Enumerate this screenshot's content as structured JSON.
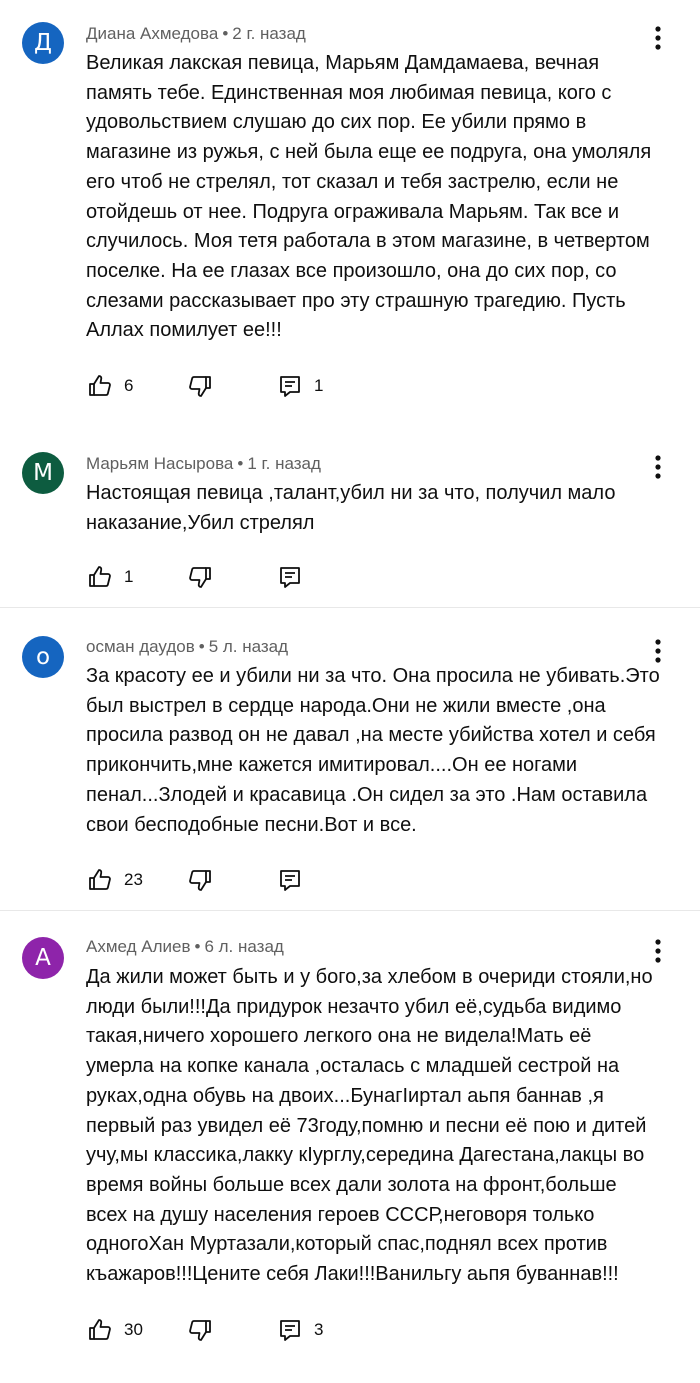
{
  "comments": [
    {
      "avatar_letter": "Д",
      "avatar_color": "#1565c0",
      "author": "Диана Ахмедова",
      "time": "2 г. назад",
      "text": "Великая лакская певица, Марьям Дамдамаева, вечная\nпамять тебе. Единственная моя любимая певица, кого с\nудовольствием слушаю до сих пор. Ее убили прямо в\nмагазине из ружья, с ней была  еще ее подруга, она умоляля\nего чтоб не стрелял, тот сказал и тебя застрелю, если не\nотойдешь от нее. Подруга ограживала Марьям. Так все и\nслучилось. Моя тетя работала в этом магазине, в четвертом\nпоселке. На ее глазах все произошло, она до сих пор, со\nслезами рассказывает про эту страшную трагедию. Пусть\nАллах помилует ее!!!",
      "likes": "6",
      "replies": "1"
    },
    {
      "avatar_letter": "М",
      "avatar_color": "#0d5c40",
      "author": "Марьям Насырова",
      "time": "1 г. назад",
      "text": "Настоящая певица ,талант,убил ни за что, получил мало\nнаказание,Убил стрелял",
      "likes": "1",
      "replies": ""
    },
    {
      "avatar_letter": "о",
      "avatar_color": "#1565c0",
      "author": "осман даудов",
      "time": "5 л. назад",
      "text": "За красоту ее и убили ни за что. Она просила не убивать.Это\nбыл выстрел в сердце народа.Они не жили вместе ,она\nпросила развод он не давал ,на месте убийства хотел и себя\nприкончить,мне кажется имитировал....Он ее ногами\nпенал...Злодей и красавица .Он сидел за это .Нам оставила\nсвои бесподобные песни.Вот и все.",
      "likes": "23",
      "replies": ""
    },
    {
      "avatar_letter": "А",
      "avatar_color": "#8e24aa",
      "author": "Ахмед Алиев",
      "time": "6 л. назад",
      "text": "Да жили может быть и у бого,за хлебом в очериди стояли,но\nлюди были!!!Да придурок незачто убил её,судьба видимо\nтакая,ничего хорошего легкого она не видела!Мать её\nумерла на копке канала  ,осталась с младшей сестрой на\nруках,одна обувь на двоих...БунагIиртал аьпя баннав ,я\nпервый раз увидел её 73году,помню и песни её пою и дитей\nучу,мы классика,лакку кIурглу,середина Дагестана,лакцы во\nвремя войны больше всех дали золота на фронт,больше\nвсех на душу населения героев СССР,неговоря только\nодногоХан Муртазали,который спас,поднял  всех против\nкъажаров!!!Цените себя Лаки!!!Ванильгу аьпя буваннав!!!",
      "likes": "30",
      "replies": "3"
    }
  ],
  "icons": {
    "like": "thumbs-up-icon",
    "dislike": "thumbs-down-icon",
    "reply": "comment-reply-icon",
    "more": "more-vertical-icon"
  }
}
